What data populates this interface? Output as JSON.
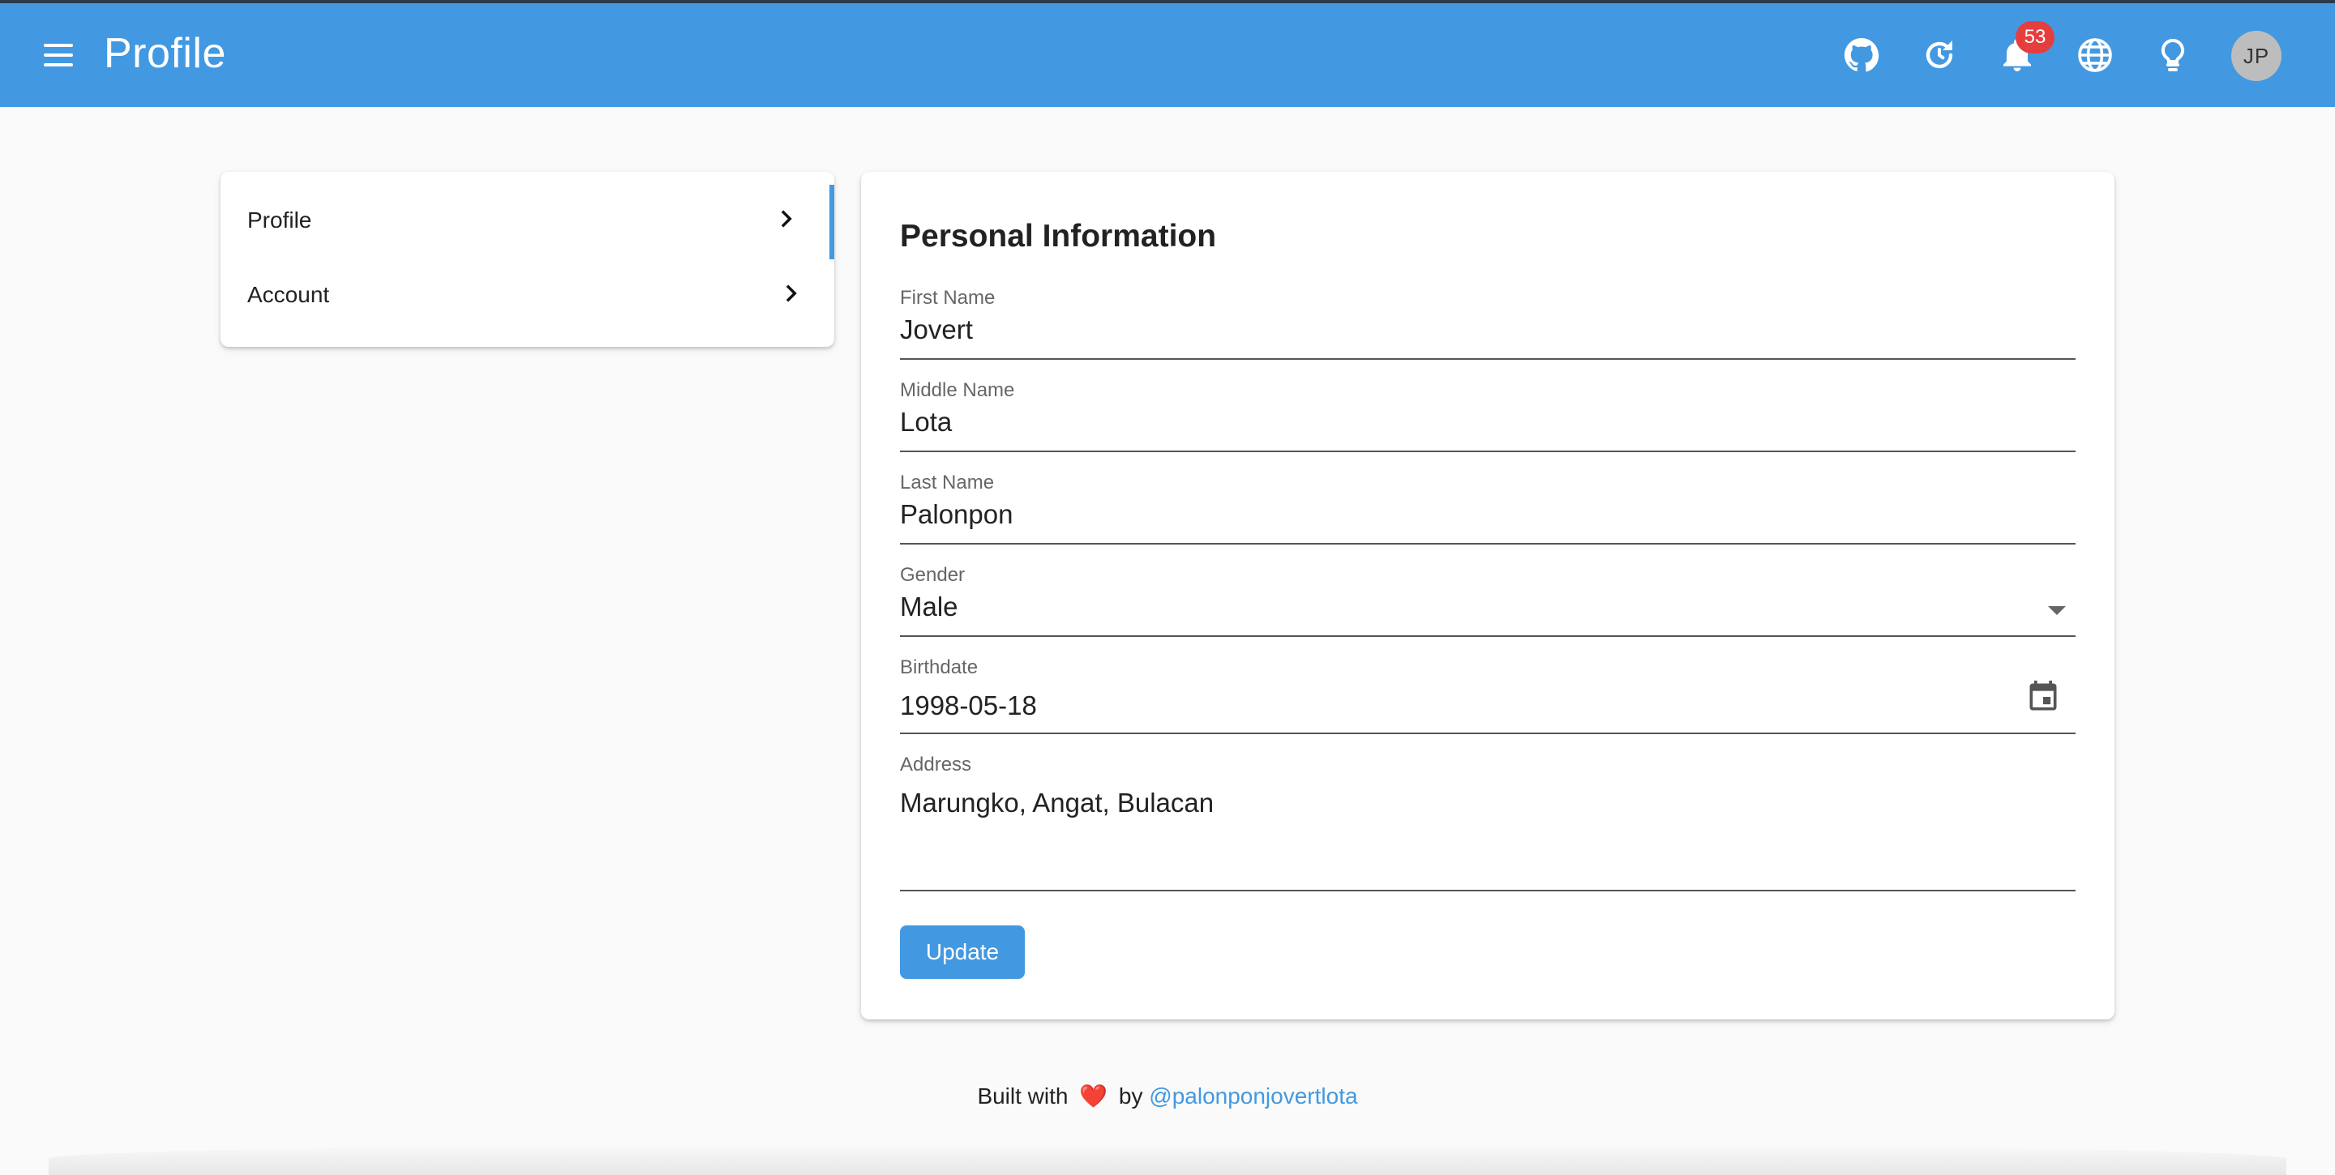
{
  "appbar": {
    "title": "Profile",
    "icons": [
      "menu-icon",
      "github-icon",
      "refresh-icon",
      "bell-icon",
      "globe-icon",
      "lightbulb-icon"
    ],
    "notification_count": "53",
    "avatar_initials": "JP",
    "color": "#4299e1"
  },
  "sidebar": {
    "items": [
      {
        "label": "Profile",
        "active": true
      },
      {
        "label": "Account",
        "active": false
      }
    ]
  },
  "form": {
    "title": "Personal Information",
    "first_name": {
      "label": "First Name",
      "value": "Jovert"
    },
    "middle_name": {
      "label": "Middle Name",
      "value": "Lota"
    },
    "last_name": {
      "label": "Last Name",
      "value": "Palonpon"
    },
    "gender": {
      "label": "Gender",
      "value": "Male"
    },
    "birthdate": {
      "label": "Birthdate",
      "value": "1998-05-18"
    },
    "address": {
      "label": "Address",
      "value": "Marungko, Angat, Bulacan"
    },
    "update_label": "Update"
  },
  "footer": {
    "prefix": "Built with",
    "heart": "❤️",
    "by": "by",
    "link": "@palonponjovertlota"
  }
}
